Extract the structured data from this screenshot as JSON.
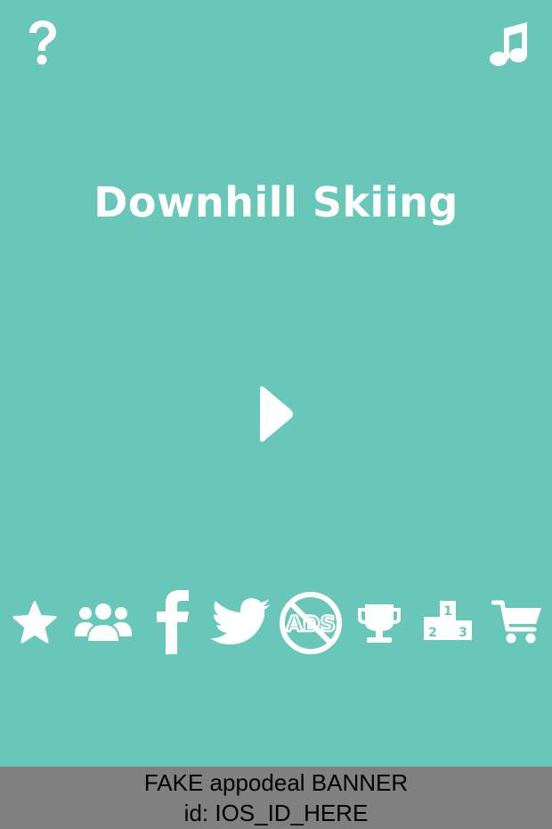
{
  "game": {
    "title": "Downhill Skiing"
  },
  "top_buttons": {
    "help_icon": "question-mark-icon",
    "music_icon": "music-note-icon"
  },
  "play_icon": "play-triangle-icon",
  "bottom_icons": [
    "star-icon",
    "friends-icon",
    "facebook-icon",
    "twitter-icon",
    "no-ads-icon",
    "trophy-icon",
    "leaderboard-podium-icon",
    "shopping-cart-icon"
  ],
  "no_ads_text": "ADS",
  "podium_numbers": [
    "1",
    "2",
    "3"
  ],
  "banner": {
    "line1": "FAKE appodeal BANNER",
    "line2": "id: IOS_ID_HERE"
  },
  "colors": {
    "background": "#69c7b9",
    "foreground": "#ffffff",
    "banner_background": "#808080",
    "banner_text": "#000000"
  }
}
